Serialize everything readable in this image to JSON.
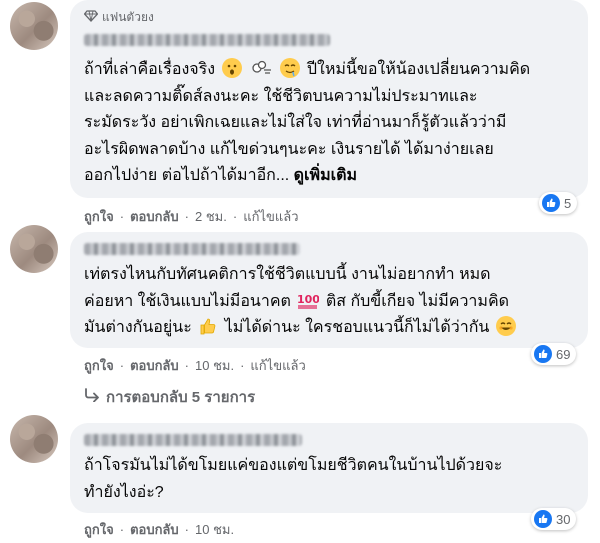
{
  "comments": [
    {
      "badge": "แฟนตัวยง",
      "lines": [
        "ถ้าที่เล่าคือเรื่องจริง",
        "ปีใหม่นี้ขอให้น้องเปลี่ยนความคิด",
        "และลดความติ๊ดส์ลงนะคะ ใช้ชีวิตบนความไม่ประมาทและ",
        "ระมัดระวัง อย่าเพิกเฉยและไม่ใส่ใจ เท่าที่อ่านมาก็รู้ตัวแล้วว่ามี",
        "อะไรผิดพลาดบ้าง แก้ไขด่วนๆนะคะ เงินรายได้ ได้มาง่ายเลย",
        "ออกไปง่าย ต่อไปถ้าได้มาอีก..."
      ],
      "see_more": "ดูเพิ่มเติม",
      "like": "ถูกใจ",
      "reply": "ตอบกลับ",
      "time": "2 ชม.",
      "edited": "แก้ไขแล้ว",
      "reactions": "5"
    },
    {
      "lines": [
        "เท่ตรงไหนกับทัศนคติการใช้ชีวิตแบบนี้ งานไม่อยากทำ หมด",
        "ค่อยหา ใช้เงินแบบไม่มีอนาคต",
        "ติส กับขี้เกียจ ไม่มีความคิด",
        "มันต่างกันอยู่นะ",
        "ไม่ได้ด่านะ ใครชอบแนวนี้ก็ไม่ได้ว่ากัน"
      ],
      "like": "ถูกใจ",
      "reply": "ตอบกลับ",
      "time": "10 ชม.",
      "edited": "แก้ไขแล้ว",
      "reactions": "69",
      "replies_label": "การตอบกลับ 5 รายการ"
    },
    {
      "lines": [
        "ถ้าโจรมันไม่ได้ขโมยแค่ของแต่ขโมยชีวิตคนในบ้านไปด้วยจะ",
        "ทำยังไงอ่ะ?"
      ],
      "like": "ถูกใจ",
      "reply": "ตอบกลับ",
      "time": "10 ชม.",
      "reactions": "30"
    }
  ],
  "colors": {
    "accent": "#1877f2",
    "bubble": "#f0f2f5",
    "secondary_text": "#65676b"
  },
  "icons": [
    "diamond-icon",
    "astonished-emoji",
    "puff-emoji",
    "drooling-emoji",
    "hundred-emoji",
    "thumbs-up-emoji",
    "smile-emoji",
    "like-reaction-icon",
    "reply-arrow-icon"
  ]
}
